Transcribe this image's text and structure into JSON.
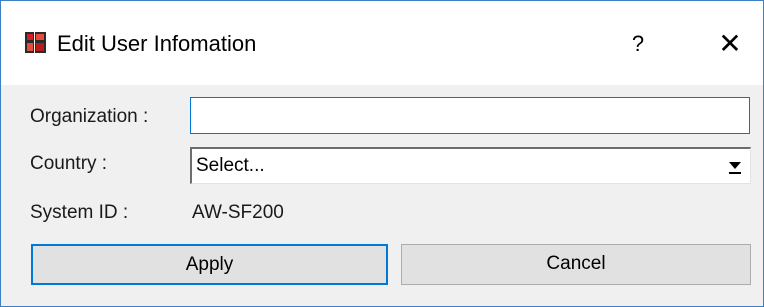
{
  "window": {
    "title": "Edit User Infomation",
    "help_label": "?",
    "close_label": "✕"
  },
  "form": {
    "organization_label": "Organization :",
    "organization_value": "",
    "country_label": "Country :",
    "country_selected": "Select...",
    "system_id_label": "System ID :",
    "system_id_value": "AW-SF200"
  },
  "buttons": {
    "apply_label": "Apply",
    "cancel_label": "Cancel"
  },
  "icons": {
    "app_icon": "app-logo-icon",
    "dropdown": "dropdown-arrow-icon"
  },
  "colors": {
    "focus_accent": "#0078d7",
    "window_border": "#3c7fc4"
  }
}
